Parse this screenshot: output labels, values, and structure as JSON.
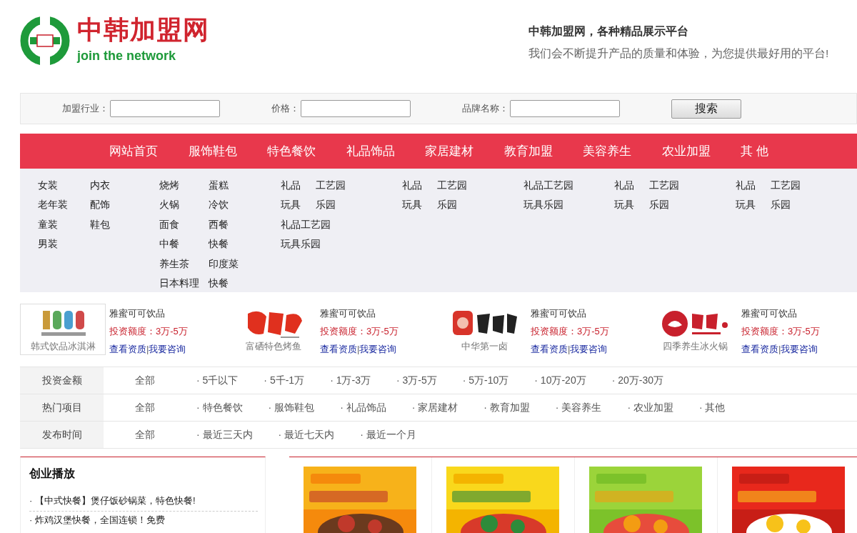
{
  "logo": {
    "title": "中韩加盟网",
    "subtitle": "join the network"
  },
  "tagline": {
    "title": "中韩加盟网，各种精品展示平台",
    "text": "我们会不断提升产品的质量和体验，为您提供最好用的平台!"
  },
  "search": {
    "fields": [
      {
        "label": "加盟行业："
      },
      {
        "label": "价格："
      },
      {
        "label": "品牌名称："
      }
    ],
    "button": "搜索"
  },
  "nav": [
    "网站首页",
    "服饰鞋包",
    "特色餐饮",
    "礼品饰品",
    "家居建材",
    "教育加盟",
    "美容养生",
    "农业加盟",
    "其 他"
  ],
  "submenu": [
    [
      [
        "女装",
        "内衣"
      ],
      [
        "老年装",
        "配饰"
      ],
      [
        "童装",
        "鞋包"
      ],
      [
        "男装"
      ]
    ],
    [
      [
        "烧烤",
        "蛋糕"
      ],
      [
        "火锅",
        "冷饮"
      ],
      [
        "面食",
        "西餐"
      ],
      [
        "中餐",
        "快餐"
      ],
      [
        "养生茶",
        "印度菜"
      ],
      [
        "日本料理",
        "快餐"
      ]
    ],
    [
      [
        "礼品",
        "工艺园"
      ],
      [
        "玩具",
        "乐园"
      ],
      [
        "礼品工艺园"
      ],
      [
        "玩具乐园"
      ]
    ],
    [
      [
        "礼品",
        "工艺园"
      ],
      [
        "玩具",
        "乐园"
      ]
    ],
    [
      [
        "礼品工艺园"
      ],
      [
        "玩具乐园"
      ]
    ],
    [
      [
        "礼品",
        "工艺园"
      ],
      [
        "玩具",
        "乐园"
      ]
    ],
    [
      [
        "礼品",
        "工艺园"
      ],
      [
        "玩具",
        "乐园"
      ]
    ]
  ],
  "brands": [
    {
      "caption": "韩式饮品冰淇淋",
      "name": "雅蜜可可饮品",
      "investment": "投资额度：3万-5万",
      "links": [
        "查看资质",
        "我要咨询"
      ],
      "separator": "|"
    },
    {
      "caption": "富硒特色烤鱼",
      "name": "雅蜜可可饮品",
      "investment": "投资额度：3万-5万",
      "links": [
        "查看资质",
        "我要咨询"
      ],
      "separator": "|"
    },
    {
      "caption": "中华第一卤",
      "name": "雅蜜可可饮品",
      "investment": "投资额度：3万-5万",
      "links": [
        "查看资质",
        "我要咨询"
      ],
      "separator": "|"
    },
    {
      "caption": "四季养生冰火锅",
      "name": "雅蜜可可饮品",
      "investment": "投资额度：3万-5万",
      "links": [
        "查看资质",
        "我要咨询"
      ],
      "separator": "|"
    }
  ],
  "filters": [
    {
      "label": "投资金额",
      "options": [
        "全部",
        "· 5千以下",
        "· 5千-1万",
        "· 1万-3万",
        "· 3万-5万",
        "· 5万-10万",
        "· 10万-20万",
        "· 20万-30万"
      ]
    },
    {
      "label": "热门项目",
      "options": [
        "全部",
        "· 特色餐饮",
        "· 服饰鞋包",
        "· 礼品饰品",
        "· 家居建材",
        "· 教育加盟",
        "· 美容养生",
        "· 农业加盟",
        "· 其他"
      ]
    },
    {
      "label": "发布时间",
      "options": [
        "全部",
        "· 最近三天内",
        "· 最近七天内",
        "· 最近一个月"
      ]
    }
  ],
  "news": {
    "title": "创业播放",
    "items": [
      "· 【中式快餐】煲仔饭砂锅菜，特色快餐!",
      "· 炸鸡汉堡快餐，全国连锁！免费"
    ]
  },
  "products": [
    {
      "kind": "picture"
    },
    {
      "kind": "picture"
    },
    {
      "kind": "picture"
    },
    {
      "kind": "picture"
    }
  ]
}
